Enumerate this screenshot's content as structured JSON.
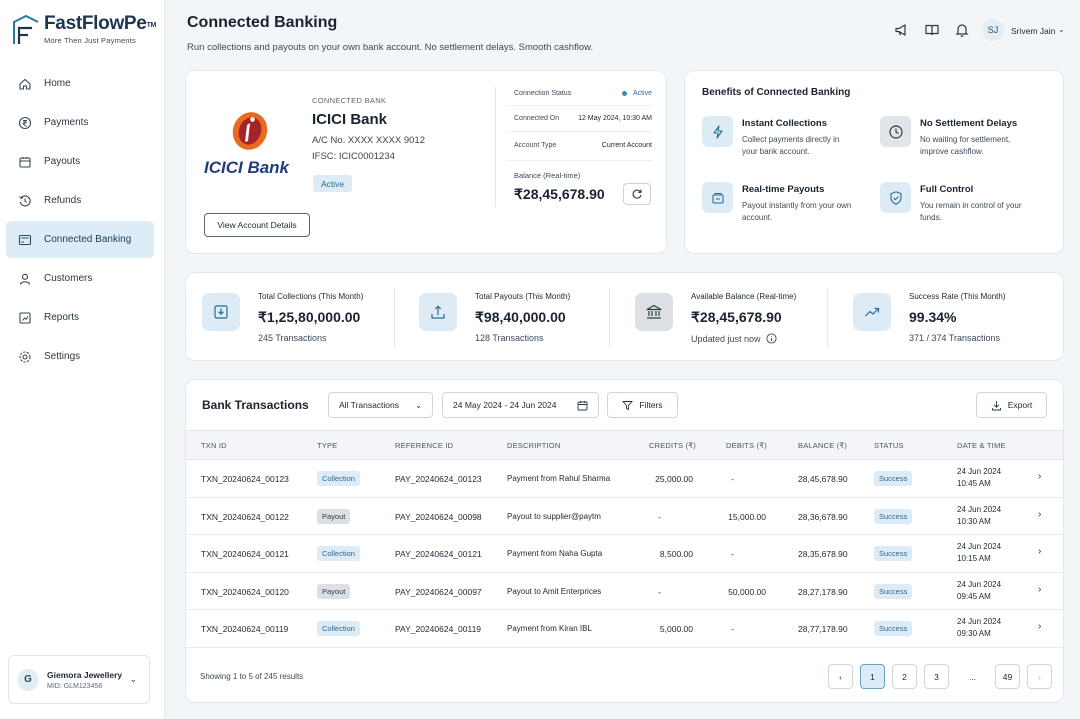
{
  "brand": {
    "name": "FastFlowPe",
    "tm": "TM",
    "tagline": "More Then Just Payments"
  },
  "nav": [
    {
      "label": "Home",
      "icon": "home-icon"
    },
    {
      "label": "Payments",
      "icon": "rupee-icon"
    },
    {
      "label": "Payouts",
      "icon": "wallet-icon"
    },
    {
      "label": "Refunds",
      "icon": "refund-icon"
    },
    {
      "label": "Connected Banking",
      "icon": "bank-icon",
      "active": true
    },
    {
      "label": "Customers",
      "icon": "user-icon"
    },
    {
      "label": "Reports",
      "icon": "report-icon"
    },
    {
      "label": "Settings",
      "icon": "gear-icon"
    }
  ],
  "org": {
    "initial": "G",
    "name": "Giemora Jewellery",
    "mid": "MID: GLM123456"
  },
  "header": {
    "title": "Connected Banking",
    "subtitle": "Run collections and payouts on your own bank account. No settlement delays. Smooth cashflow.",
    "user_initials": "SJ",
    "user_name": "Srivem Jain"
  },
  "bank": {
    "label": "CONNECTED BANK",
    "logo_text": "ICICI Bank",
    "name": "ICICI Bank",
    "account": "A/C No. XXXX XXXX 9012",
    "ifsc": "IFSC: ICIC0001234",
    "status": "Active",
    "view_btn": "View Account Details",
    "conn_status_label": "Connection Status",
    "conn_status_value": "Active",
    "connected_on_label": "Connected On",
    "connected_on_value": "12 May 2024, 10:30 AM",
    "account_type_label": "Account Type",
    "account_type_value": "Current Account",
    "balance_label": "Balance (Real-time)",
    "balance_value": "₹28,45,678.90"
  },
  "benefits": {
    "title": "Benefits of Connected Banking",
    "items": [
      {
        "title": "Instant Collections",
        "desc": "Collect payments directly in your bank account."
      },
      {
        "title": "No Settlement Delays",
        "desc": "No waiting for settlement, improve cashflow."
      },
      {
        "title": "Real-time Payouts",
        "desc": "Payout instantly from your own account."
      },
      {
        "title": "Full Control",
        "desc": "You remain in control of your funds."
      }
    ]
  },
  "stats": [
    {
      "label": "Total Collections (This Month)",
      "value": "₹1,25,80,000.00",
      "sub": "245 Transactions"
    },
    {
      "label": "Total Payouts (This Month)",
      "value": "₹98,40,000.00",
      "sub": "128 Transactions"
    },
    {
      "label": "Available Balance (Real-time)",
      "value": "₹28,45,678.90",
      "sub": "Updated just now"
    },
    {
      "label": "Success Rate (This Month)",
      "value": "99.34%",
      "sub": "371 / 374 Transactions"
    }
  ],
  "transactions": {
    "title": "Bank Transactions",
    "filter_select": "All Transactions",
    "date_range": "24 May 2024 - 24 Jun 2024",
    "filters_btn": "Filters",
    "export_btn": "Export",
    "columns": [
      "TXN ID",
      "TYPE",
      "REFERENCE ID",
      "DESCRIPTION",
      "CREDITS (₹)",
      "DEBITS (₹)",
      "BALANCE (₹)",
      "STATUS",
      "DATE & TIME"
    ],
    "rows": [
      {
        "txn": "TXN_20240624_00123",
        "type": "Collection",
        "ref": "PAY_20240624_00123",
        "desc": "Payment from Rahul Sharma",
        "credit": "25,000.00",
        "debit": "-",
        "balance": "28,45,678.90",
        "status": "Success",
        "date": "24 Jun 2024",
        "time": "10:45 AM"
      },
      {
        "txn": "TXN_20240624_00122",
        "type": "Payout",
        "ref": "PAY_20240624_00098",
        "desc": "Payout to supplier@paytm",
        "credit": "-",
        "debit": "15,000.00",
        "balance": "28,36,678.90",
        "status": "Success",
        "date": "24 Jun 2024",
        "time": "10:30 AM"
      },
      {
        "txn": "TXN_20240624_00121",
        "type": "Collection",
        "ref": "PAY_20240624_00121",
        "desc": "Payment from Naha Gupta",
        "credit": "8,500.00",
        "debit": "-",
        "balance": "28,35,678.90",
        "status": "Success",
        "date": "24 Jun 2024",
        "time": "10:15 AM"
      },
      {
        "txn": "TXN_20240624_00120",
        "type": "Payout",
        "ref": "PAY_20240624_00097",
        "desc": "Payout to Amit Enterprices",
        "credit": "-",
        "debit": "50,000.00",
        "balance": "28,27,178.90",
        "status": "Success",
        "date": "24 Jun 2024",
        "time": "09:45 AM"
      },
      {
        "txn": "TXN_20240624_00119",
        "type": "Collection",
        "ref": "PAY_20240624_00119",
        "desc": "Payment from Kiran IBL",
        "credit": "5,000.00",
        "debit": "-",
        "balance": "28,77,178.90",
        "status": "Success",
        "date": "24 Jun 2024",
        "time": "09:30 AM"
      }
    ],
    "footer": "Showing 1 to 5 of 245 results",
    "pages": [
      "1",
      "2",
      "3",
      "...",
      "49"
    ]
  }
}
